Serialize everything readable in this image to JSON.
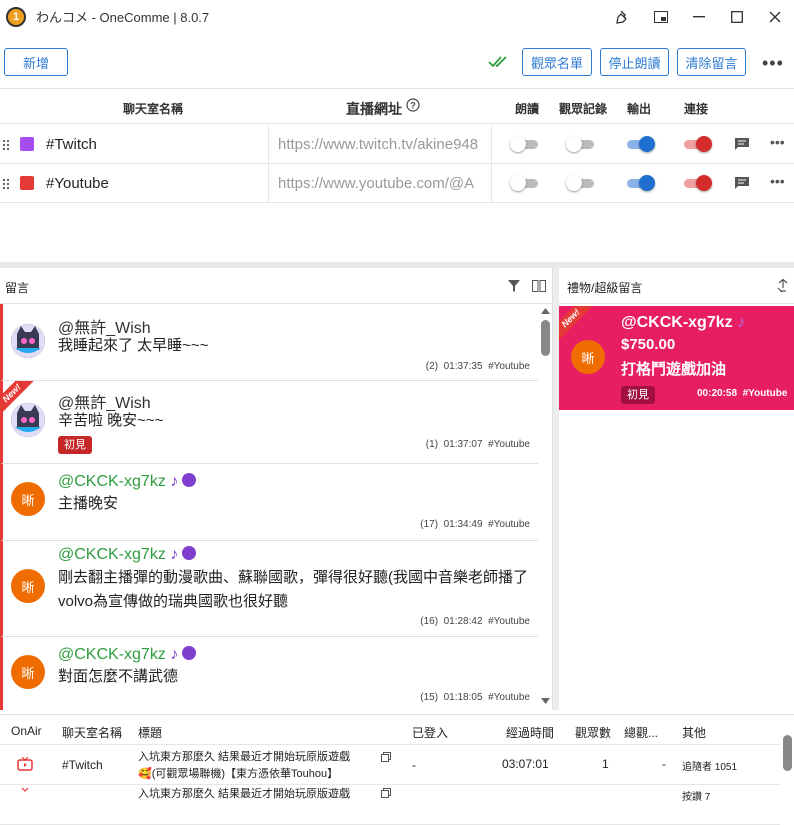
{
  "titlebar": {
    "title": "わんコメ - OneComme | 8.0.7",
    "logo_text": "1"
  },
  "toolbar": {
    "add_label": "新增",
    "viewer_list_label": "觀眾名單",
    "stop_reading_label": "停止朗讀",
    "clear_label": "清除留言"
  },
  "grid": {
    "headers": {
      "room_name": "聊天室名稱",
      "url": "直播網址",
      "read": "朗讀",
      "viewer_log": "觀眾記錄",
      "output": "輸出",
      "connect": "連接"
    },
    "rows": [
      {
        "name": "#Twitch",
        "color": "#a64cf0",
        "url": "https://www.twitch.tv/akine948",
        "read": false,
        "log": false,
        "output": true,
        "connect": true
      },
      {
        "name": "#Youtube",
        "color": "#e53935",
        "url": "https://www.youtube.com/@A",
        "read": false,
        "log": false,
        "output": true,
        "connect": true
      }
    ]
  },
  "comments_panel": {
    "title": "留言"
  },
  "gifts_panel": {
    "title": "禮物/超級留言"
  },
  "comments": [
    {
      "user": "@無許_Wish",
      "text": "我睡起來了 太早睡~~~",
      "count": "(2)",
      "time": "01:37:35",
      "source": "#Youtube",
      "badge": "",
      "new": false
    },
    {
      "user": "@無許_Wish",
      "text": "辛苦啦 晚安~~~",
      "count": "(1)",
      "time": "01:37:07",
      "source": "#Youtube",
      "badge": "初見",
      "new": true
    },
    {
      "user": "@CKCK-xg7kz",
      "text": "主播晚安",
      "count": "(17)",
      "time": "01:34:49",
      "source": "#Youtube",
      "badge": "",
      "new": false,
      "avatar": "晰"
    },
    {
      "user": "@CKCK-xg7kz",
      "text": "剛去翻主播彈的動漫歌曲、蘇聯國歌，彈得很好聽(我國中音樂老師播了volvo為宣傳做的瑞典國歌也很好聽",
      "count": "(16)",
      "time": "01:28:42",
      "source": "#Youtube",
      "badge": "",
      "new": false,
      "avatar": "晰"
    },
    {
      "user": "@CKCK-xg7kz",
      "text": "對面怎麼不講武德",
      "count": "(15)",
      "time": "01:18:05",
      "source": "#Youtube",
      "badge": "",
      "new": false,
      "avatar": "晰"
    }
  ],
  "note_glyph": "♪",
  "new_label": "New!",
  "gift": {
    "user": "@CKCK-xg7kz",
    "amount": "$750.00",
    "text": "打格鬥遊戲加油",
    "badge": "初見",
    "time": "00:20:58",
    "source": "#Youtube",
    "avatar": "晰"
  },
  "bottom": {
    "headers": {
      "onair": "OnAir",
      "room": "聊天室名稱",
      "title": "標題",
      "logged": "已登入",
      "elapsed": "經過時間",
      "viewers": "觀眾數",
      "total": "總觀...",
      "other": "其他"
    },
    "rows": [
      {
        "room": "#Twitch",
        "title1": "入坑東方那麼久 結果最近才開始玩原版遊戲",
        "title2": "🥰(可觀眾場聯機)【東方憑依華Touhou】",
        "logged": "-",
        "elapsed": "03:07:01",
        "viewers": "1",
        "total": "-",
        "other": "追隨者 1051"
      },
      {
        "room": "",
        "title1": "入坑東方那麼久 結果最近才開始玩原版遊戲",
        "title2": "",
        "logged": "",
        "elapsed": "",
        "viewers": "",
        "total": "",
        "other": "按讚 7"
      }
    ]
  },
  "colors": {
    "accent": "#2f7bd3",
    "twitch": "#a64cf0",
    "youtube": "#e53935",
    "gift_bg": "#e81e63",
    "username_green": "#2e9e3f"
  }
}
